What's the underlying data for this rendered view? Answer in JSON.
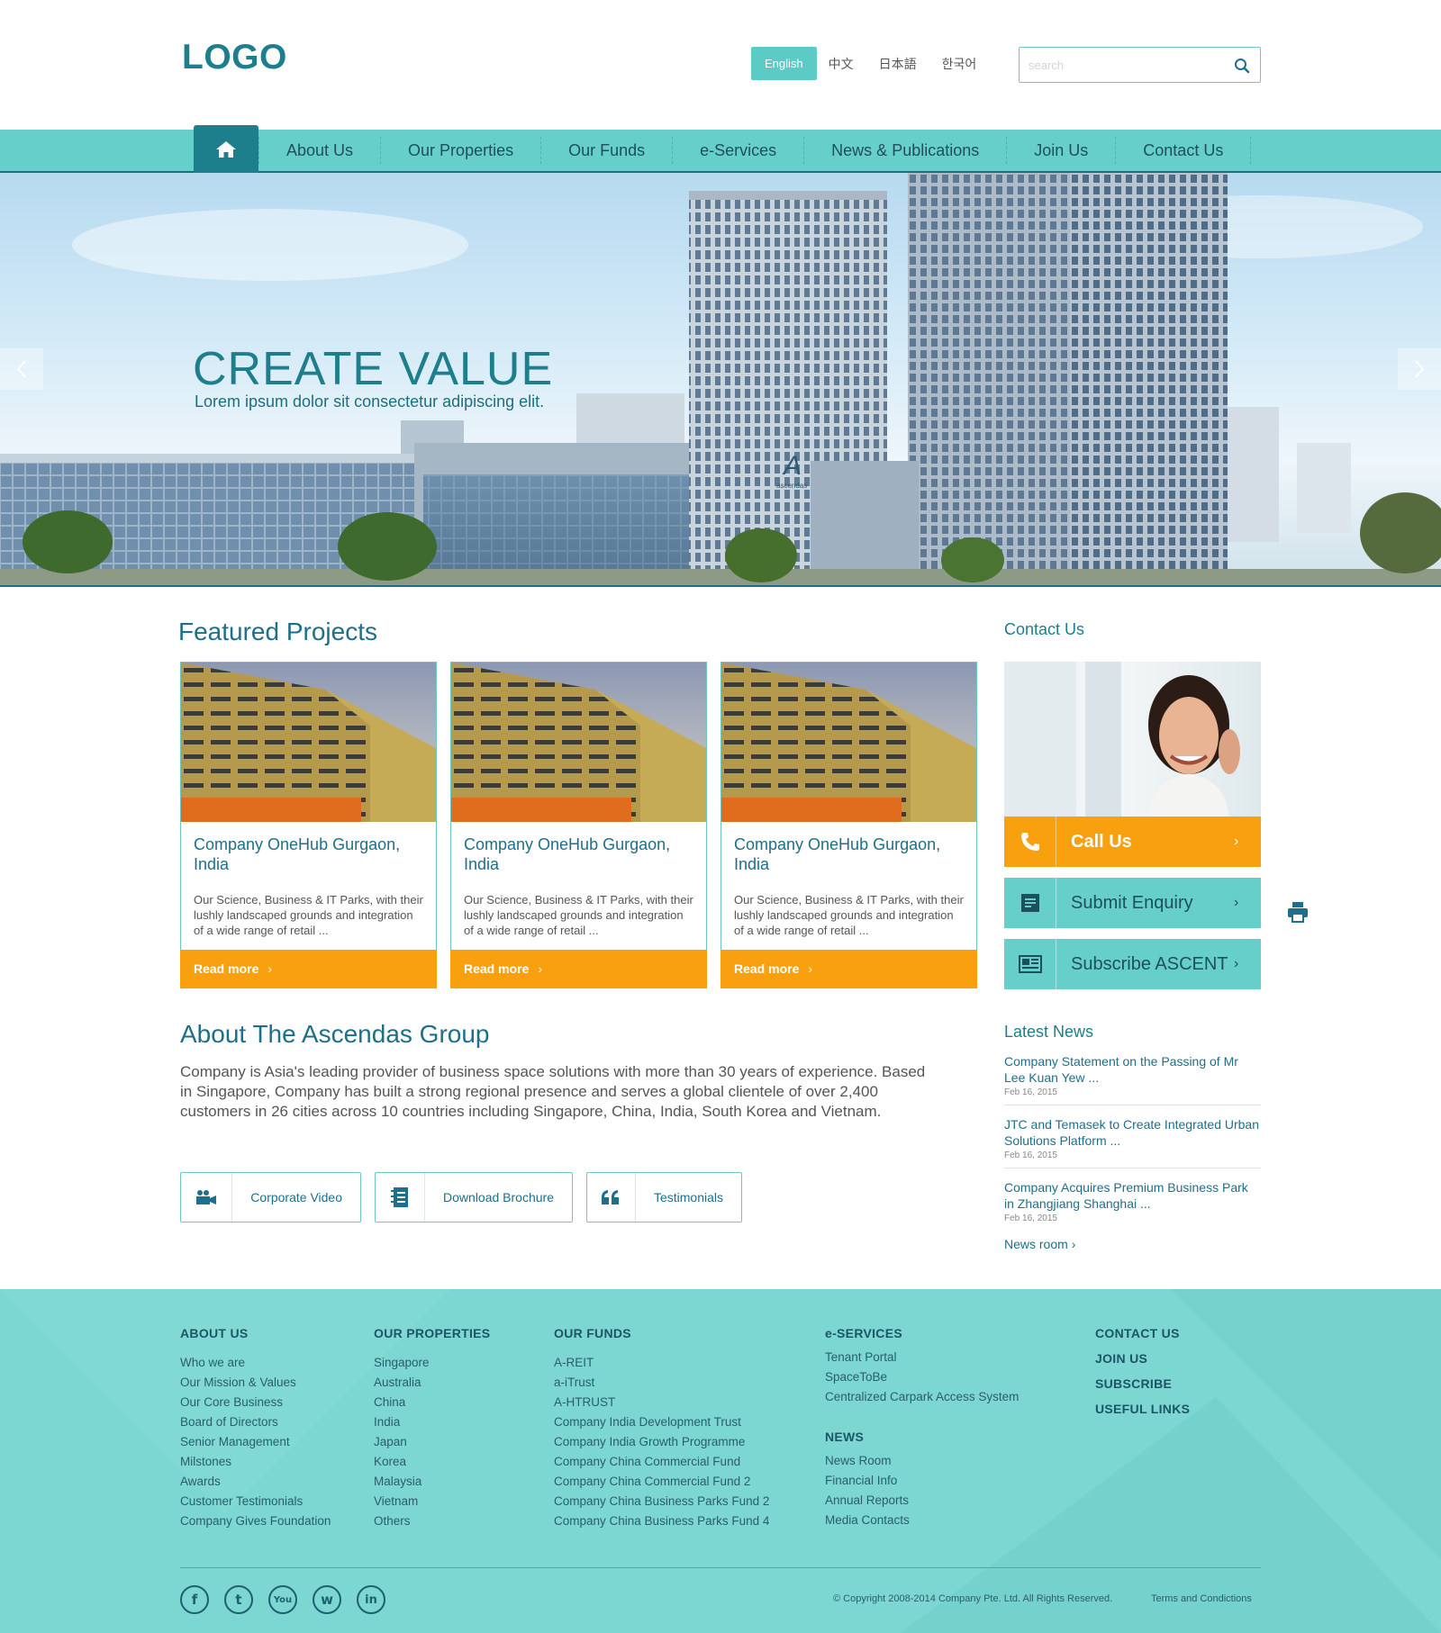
{
  "header": {
    "logo": "LOGO",
    "languages": [
      {
        "label": "English",
        "active": true
      },
      {
        "label": "中文",
        "active": false
      },
      {
        "label": "日本語",
        "active": false
      },
      {
        "label": "한국어",
        "active": false
      }
    ],
    "search_placeholder": "search"
  },
  "nav": {
    "items": [
      "About Us",
      "Our Properties",
      "Our Funds",
      "e-Services",
      "News & Publications",
      "Join Us",
      "Contact Us"
    ]
  },
  "hero": {
    "title": "CREATE VALUE",
    "subtitle": "Lorem ipsum dolor sit consectetur adipiscing elit.",
    "building_sign": "ascendas"
  },
  "featured": {
    "title": "Featured Projects",
    "cards": [
      {
        "title": "Company OneHub Gurgaon, India",
        "desc": "Our Science, Business & IT Parks, with their lushly landscaped grounds and integration of a wide range of retail ...",
        "more": "Read more"
      },
      {
        "title": "Company OneHub Gurgaon, India",
        "desc": "Our Science, Business & IT Parks, with their lushly landscaped grounds and integration of a wide range of retail ...",
        "more": "Read more"
      },
      {
        "title": "Company OneHub Gurgaon, India",
        "desc": "Our Science, Business & IT Parks, with their lushly landscaped grounds and integration of a wide range of retail ...",
        "more": "Read more"
      }
    ]
  },
  "about": {
    "title": "About The Ascendas Group",
    "text": "Company is Asia's leading provider of business space solutions with more than 30 years of experience. Based in Singapore, Company has built a strong regional presence and serves a global clientele of over 2,400 customers in 26 cities across 10 countries including Singapore, China, India, South Korea and Vietnam.",
    "buttons": [
      {
        "label": "Corporate Video",
        "icon": "video-camera-icon"
      },
      {
        "label": "Download Brochure",
        "icon": "brochure-icon"
      },
      {
        "label": "Testimonials",
        "icon": "quote-icon"
      }
    ]
  },
  "sidebar": {
    "contact_title": "Contact Us",
    "actions": [
      {
        "label": "Call Us",
        "icon": "phone-icon",
        "color": "#f8a00e"
      },
      {
        "label": "Submit Enquiry",
        "icon": "form-icon",
        "color": "#66cfc9"
      },
      {
        "label": "Subscribe ASCENT",
        "icon": "newsletter-icon",
        "color": "#66cfc9"
      }
    ],
    "news_title": "Latest News",
    "news": [
      {
        "title": "Company Statement on the Passing of Mr Lee Kuan Yew ...",
        "date": "Feb 16, 2015"
      },
      {
        "title": "JTC and Temasek to Create Integrated Urban Solutions Platform ...",
        "date": "Feb 16, 2015"
      },
      {
        "title": "Company Acquires Premium Business Park in Zhangjiang Shanghai ...",
        "date": "Feb 16, 2015"
      }
    ],
    "news_room": "News room"
  },
  "footer": {
    "about": {
      "head": "ABOUT US",
      "links": [
        "Who we are",
        "Our Mission & Values",
        "Our Core Business",
        "Board of Directors",
        "Senior Management",
        "Milstones",
        "Awards",
        "Customer Testimonials",
        "Company Gives Foundation"
      ]
    },
    "properties": {
      "head": "OUR PROPERTIES",
      "links": [
        "Singapore",
        "Australia",
        "China",
        "India",
        "Japan",
        "Korea",
        "Malaysia",
        "Vietnam",
        "Others"
      ]
    },
    "funds": {
      "head": "OUR FUNDS",
      "links": [
        "A-REIT",
        "a-iTrust",
        "A-HTRUST",
        "Company India Development Trust",
        "Company India Growth Programme",
        "Company China Commercial Fund",
        "Company China Commercial Fund 2",
        "Company China Business Parks Fund 2",
        "Company China Business Parks Fund 4"
      ]
    },
    "eservices": {
      "head": "e-SERVICES",
      "links": [
        "Tenant Portal",
        "SpaceToBe",
        "Centralized Carpark Access System"
      ]
    },
    "news": {
      "head": "NEWS",
      "links": [
        "News Room",
        "Financial Info",
        "Annual Reports",
        "Media Contacts"
      ]
    },
    "right": [
      "CONTACT US",
      "JOIN US",
      "SUBSCRIBE",
      "USEFUL LINKS"
    ],
    "social": [
      "facebook-icon",
      "twitter-icon",
      "youtube-icon",
      "weibo-icon",
      "linkedin-icon"
    ],
    "social_glyphs": [
      "f",
      "t",
      "You",
      "w",
      "in"
    ],
    "copyright": "© Copyright 2008-2014 Company Pte. Ltd. All Rights Reserved.",
    "terms": "Terms and Condictions"
  },
  "colors": {
    "teal": "#66cfc9",
    "dark_teal": "#1d7e8c",
    "orange": "#f8a00e",
    "footer_bg": "#7cd6d1"
  }
}
